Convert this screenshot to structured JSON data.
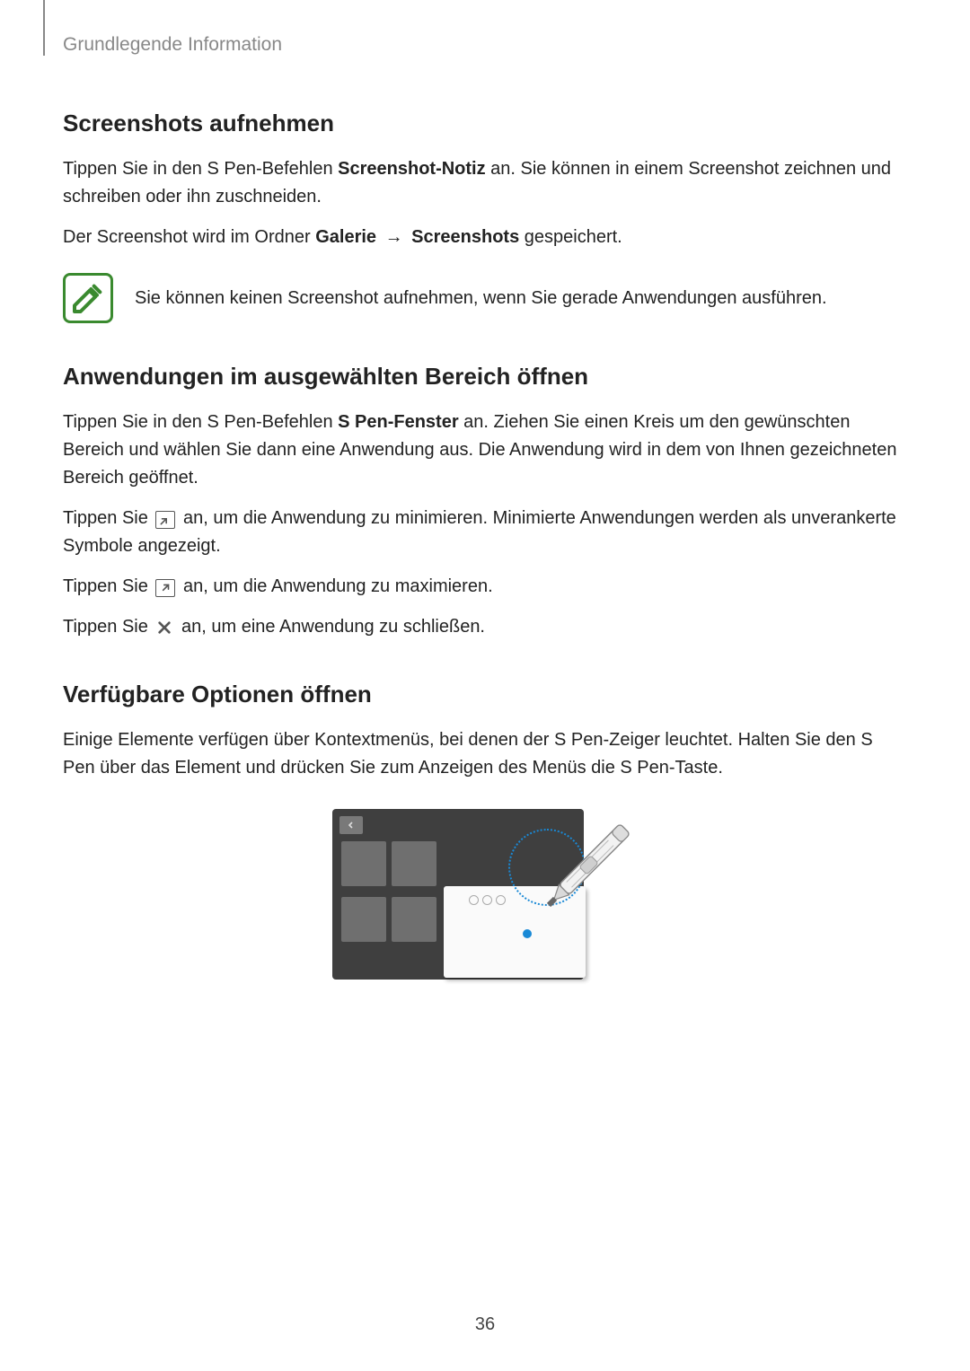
{
  "breadcrumb": "Grundlegende Information",
  "section1": {
    "heading": "Screenshots aufnehmen",
    "p1_a": "Tippen Sie in den S Pen-Befehlen ",
    "p1_bold": "Screenshot-Notiz",
    "p1_b": " an. Sie können in einem Screenshot zeichnen und schreiben oder ihn zuschneiden.",
    "p2_a": "Der Screenshot wird im Ordner ",
    "p2_bold1": "Galerie",
    "p2_arrow": " → ",
    "p2_bold2": "Screenshots",
    "p2_b": " gespeichert.",
    "note": "Sie können keinen Screenshot aufnehmen, wenn Sie gerade Anwendungen ausführen."
  },
  "section2": {
    "heading": "Anwendungen im ausgewählten Bereich öffnen",
    "p1_a": "Tippen Sie in den S Pen-Befehlen ",
    "p1_bold": "S Pen-Fenster",
    "p1_b": " an. Ziehen Sie einen Kreis um den gewünschten Bereich und wählen Sie dann eine Anwendung aus. Die Anwendung wird in dem von Ihnen gezeichneten Bereich geöffnet.",
    "p2_a": "Tippen Sie ",
    "p2_b": " an, um die Anwendung zu minimieren. Minimierte Anwendungen werden als unverankerte Symbole angezeigt.",
    "p3_a": "Tippen Sie ",
    "p3_b": " an, um die Anwendung zu maximieren.",
    "p4_a": "Tippen Sie ",
    "p4_b": " an, um eine Anwendung zu schließen."
  },
  "section3": {
    "heading": "Verfügbare Optionen öffnen",
    "p1": "Einige Elemente verfügen über Kontextmenüs, bei denen der S Pen-Zeiger leuchtet. Halten Sie den S Pen über das Element und drücken Sie zum Anzeigen des Menüs die S Pen-Taste."
  },
  "page_number": "36"
}
